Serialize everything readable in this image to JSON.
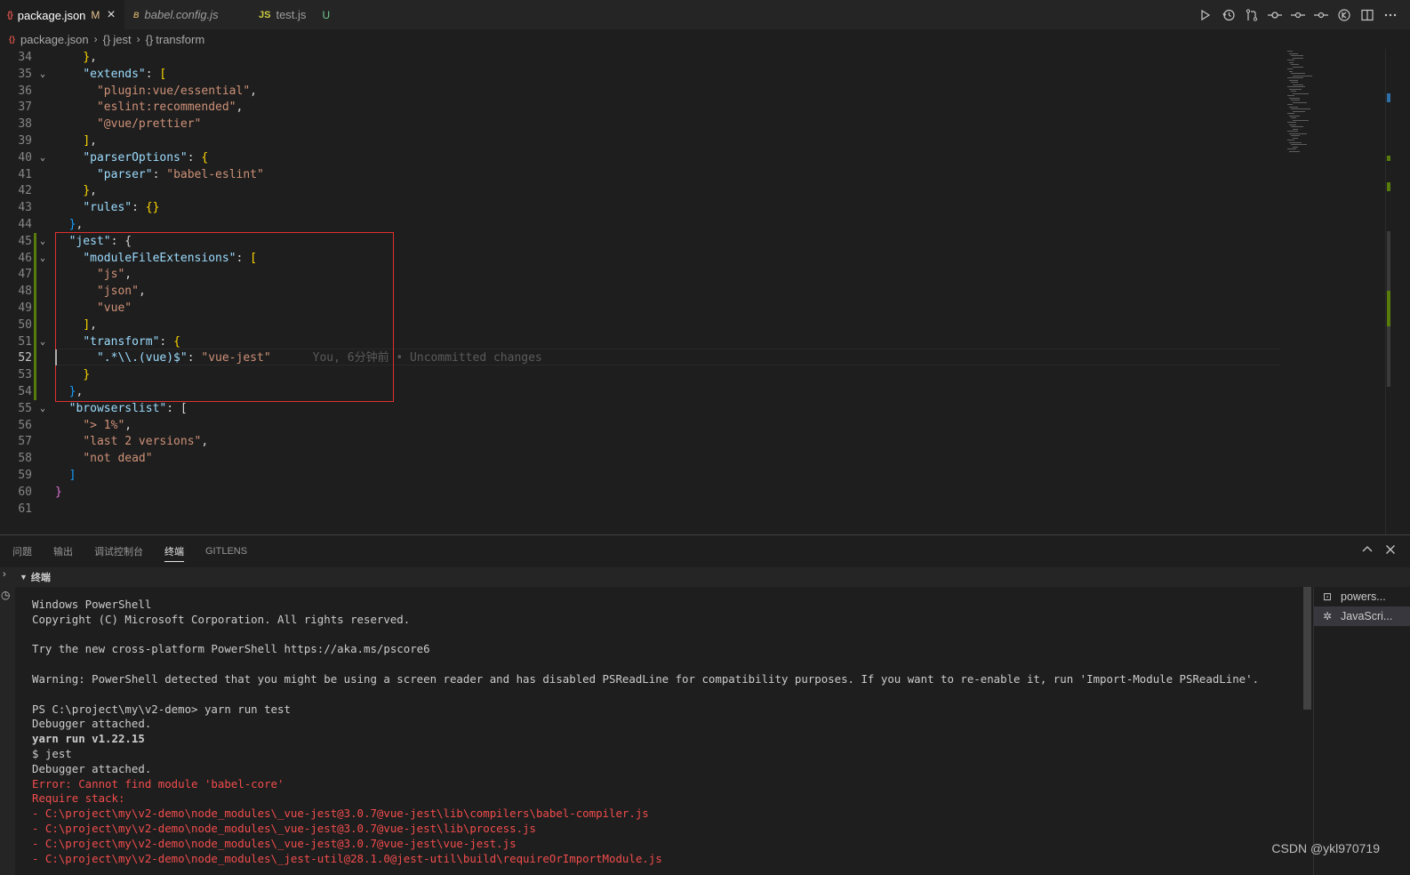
{
  "tabs": [
    {
      "icon": "json",
      "label": "package.json",
      "badge": "M",
      "active": true
    },
    {
      "icon": "babel",
      "label": "babel.config.js",
      "badge": "",
      "active": false
    },
    {
      "icon": "JS",
      "label": "test.js",
      "badge": "U",
      "active": false
    }
  ],
  "breadcrumb": [
    "package.json",
    "jest",
    "transform"
  ],
  "editor_actions": [
    "run-icon",
    "timeline-icon",
    "compare-changes-icon",
    "git-commit-icon",
    "previous-change-icon",
    "next-change-icon",
    "blame-icon",
    "split-editor-icon",
    "more-actions-icon"
  ],
  "code_lines": [
    {
      "n": "34",
      "text": "    },"
    },
    {
      "n": "35",
      "text": "    \"extends\": ["
    },
    {
      "n": "36",
      "text": "      \"plugin:vue/essential\","
    },
    {
      "n": "37",
      "text": "      \"eslint:recommended\","
    },
    {
      "n": "38",
      "text": "      \"@vue/prettier\""
    },
    {
      "n": "39",
      "text": "    ],"
    },
    {
      "n": "40",
      "text": "    \"parserOptions\": {"
    },
    {
      "n": "41",
      "text": "      \"parser\": \"babel-eslint\""
    },
    {
      "n": "42",
      "text": "    },"
    },
    {
      "n": "43",
      "text": "    \"rules\": {}"
    },
    {
      "n": "44",
      "text": "  },"
    },
    {
      "n": "45",
      "text": "  \"jest\": {"
    },
    {
      "n": "46",
      "text": "    \"moduleFileExtensions\": ["
    },
    {
      "n": "47",
      "text": "      \"js\","
    },
    {
      "n": "48",
      "text": "      \"json\","
    },
    {
      "n": "49",
      "text": "      \"vue\""
    },
    {
      "n": "50",
      "text": "    ],"
    },
    {
      "n": "51",
      "text": "    \"transform\": {"
    },
    {
      "n": "52",
      "text": "      \".*\\\\.(vue)$\": \"vue-jest\""
    },
    {
      "n": "53",
      "text": "    }"
    },
    {
      "n": "54",
      "text": "  },"
    },
    {
      "n": "55",
      "text": "  \"browserslist\": ["
    },
    {
      "n": "56",
      "text": "    \"> 1%\","
    },
    {
      "n": "57",
      "text": "    \"last 2 versions\","
    },
    {
      "n": "58",
      "text": "    \"not dead\""
    },
    {
      "n": "59",
      "text": "  ]"
    },
    {
      "n": "60",
      "text": "}"
    },
    {
      "n": "61",
      "text": ""
    }
  ],
  "blame_annotation": "You, 6分钟前 • Uncommitted changes",
  "current_line": "52",
  "panel": {
    "tabs": [
      "问题",
      "输出",
      "调试控制台",
      "终端",
      "GITLENS"
    ],
    "active_tab": "终端",
    "terminal_title": "终端",
    "terminal_instances": [
      {
        "icon": "terminal-icon",
        "label": "powers..."
      },
      {
        "icon": "debug-icon",
        "label": "JavaScri..."
      }
    ]
  },
  "terminal_lines": [
    {
      "text": "Windows PowerShell",
      "style": "normal"
    },
    {
      "text": "Copyright (C) Microsoft Corporation. All rights reserved.",
      "style": "normal"
    },
    {
      "text": "",
      "style": "normal"
    },
    {
      "text": "Try the new cross-platform PowerShell https://aka.ms/pscore6",
      "style": "normal"
    },
    {
      "text": "",
      "style": "normal"
    },
    {
      "text": "Warning: PowerShell detected that you might be using a screen reader and has disabled PSReadLine for compatibility purposes. If you want to re-enable it, run 'Import-Module PSReadLine'.",
      "style": "normal"
    },
    {
      "text": "",
      "style": "normal"
    },
    {
      "text": "PS C:\\project\\my\\v2-demo> yarn run test",
      "style": "normal"
    },
    {
      "text": "Debugger attached.",
      "style": "normal"
    },
    {
      "text": "yarn run v1.22.15",
      "style": "bold"
    },
    {
      "text": "$ jest",
      "style": "normal"
    },
    {
      "text": "Debugger attached.",
      "style": "normal"
    },
    {
      "text": "Error: Cannot find module 'babel-core'",
      "style": "err"
    },
    {
      "text": "Require stack:",
      "style": "err"
    },
    {
      "text": "- C:\\project\\my\\v2-demo\\node_modules\\_vue-jest@3.0.7@vue-jest\\lib\\compilers\\babel-compiler.js",
      "style": "err"
    },
    {
      "text": "- C:\\project\\my\\v2-demo\\node_modules\\_vue-jest@3.0.7@vue-jest\\lib\\process.js",
      "style": "err"
    },
    {
      "text": "- C:\\project\\my\\v2-demo\\node_modules\\_vue-jest@3.0.7@vue-jest\\vue-jest.js",
      "style": "err"
    },
    {
      "text": "- C:\\project\\my\\v2-demo\\node_modules\\_jest-util@28.1.0@jest-util\\build\\requireOrImportModule.js",
      "style": "err"
    }
  ],
  "watermark": "CSDN @ykl970719",
  "colors": {
    "accent_error": "#f14c4c",
    "highlight_box": "#e03030",
    "git_added": "#587c0c",
    "modified_badge": "#e2c08d",
    "untracked_badge": "#73c991"
  }
}
